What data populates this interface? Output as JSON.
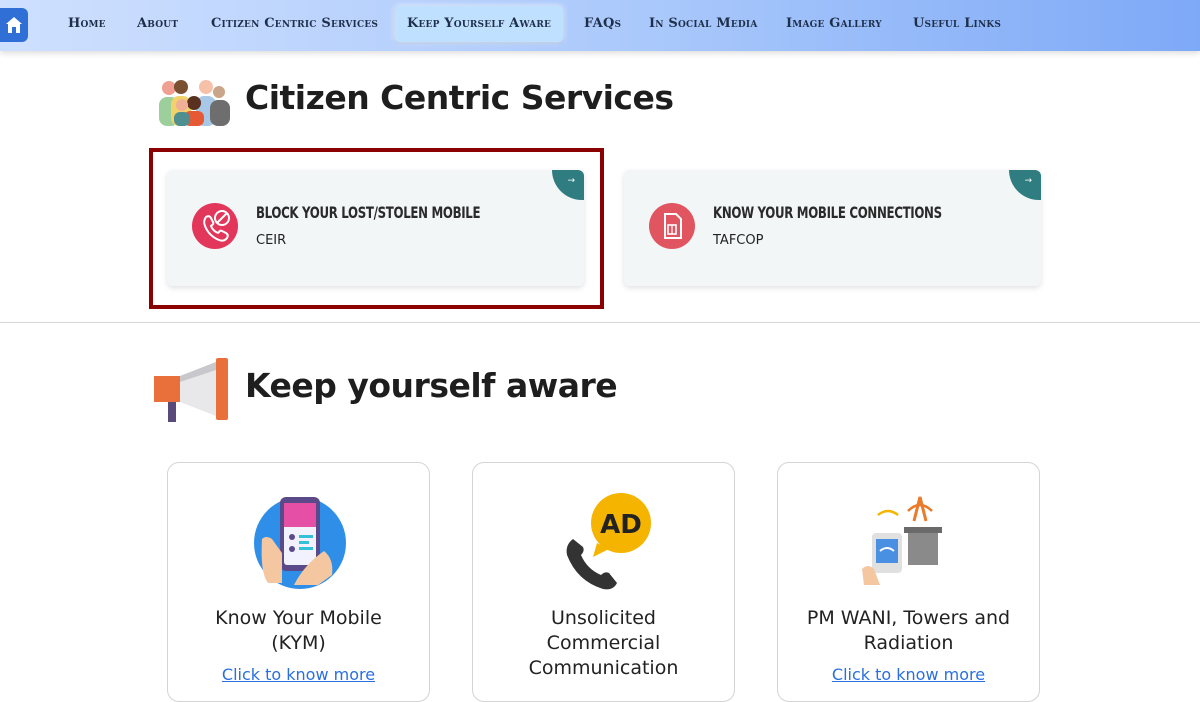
{
  "nav": {
    "items": [
      "Home",
      "About",
      "Citizen Centric Services",
      "Keep Yourself Aware",
      "FAQs",
      "In Social Media",
      "Image Gallery",
      "Useful Links"
    ]
  },
  "citizen": {
    "title": "Citizen Centric Services",
    "cards": [
      {
        "title": "BLOCK YOUR LOST/STOLEN MOBILE",
        "sub": "CEIR",
        "arrow": "→"
      },
      {
        "title": "KNOW YOUR MOBILE CONNECTIONS",
        "sub": "TAFCOP",
        "arrow": "→"
      }
    ]
  },
  "aware": {
    "title": "Keep yourself aware",
    "cards": [
      {
        "title_l1": "Know Your Mobile",
        "title_l2": "(KYM)",
        "link": "Click to know more"
      },
      {
        "title_l1": "Unsolicited",
        "title_l2": "Commercial",
        "title_l3": "Communication"
      },
      {
        "title_l1": "PM WANI, Towers and",
        "title_l2": "Radiation",
        "link": "Click to know more"
      }
    ]
  },
  "colors": {
    "accent_teal": "#2f7d80",
    "highlight_border": "#8b0000",
    "link_blue": "#2a6fe0"
  }
}
